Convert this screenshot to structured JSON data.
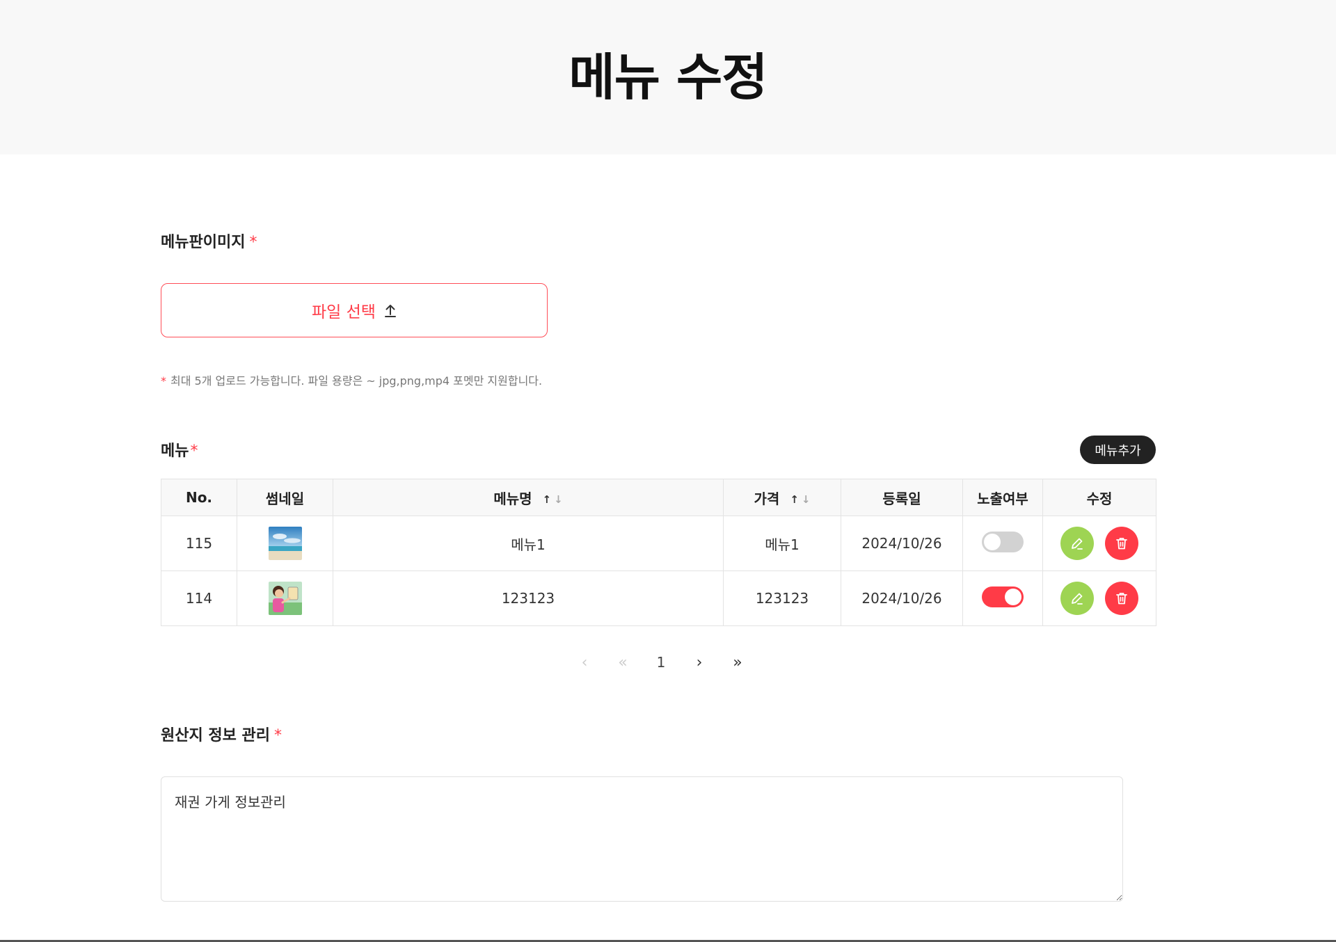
{
  "header": {
    "title": "메뉴 수정"
  },
  "menu_image": {
    "label": "메뉴판이미지",
    "required_mark": "*",
    "file_button_label": "파일 선택",
    "note_star": "*",
    "note": "최대 5개 업로드 가능합니다. 파일 용량은 ~ jpg,png,mp4 포멧만 지원합니다."
  },
  "menu": {
    "label": "메뉴",
    "required_mark": "*",
    "add_button": "메뉴추가",
    "columns": [
      "No.",
      "썸네일",
      "메뉴명",
      "가격",
      "등록일",
      "노출여부",
      "수정"
    ],
    "sort_up": "↑",
    "sort_down": "↓",
    "rows": [
      {
        "no": "115",
        "thumbnail": "beach-photo",
        "name": "메뉴1",
        "price": "메뉴1",
        "date": "2024/10/26",
        "visible": false
      },
      {
        "no": "114",
        "thumbnail": "cartoon-character",
        "name": "123123",
        "price": "123123",
        "date": "2024/10/26",
        "visible": true
      }
    ]
  },
  "pagination": {
    "prev": "‹",
    "first": "«",
    "current_page": "1",
    "next": "›",
    "last": "»"
  },
  "origin": {
    "label": "원산지 정보 관리",
    "required_mark": "*",
    "value": "재권 가게 정보관리"
  },
  "colors": {
    "accent_red": "#ff3b47",
    "edit_green": "#9ed453",
    "toggle_off": "#d2d2d2",
    "dark_button": "#222222"
  }
}
